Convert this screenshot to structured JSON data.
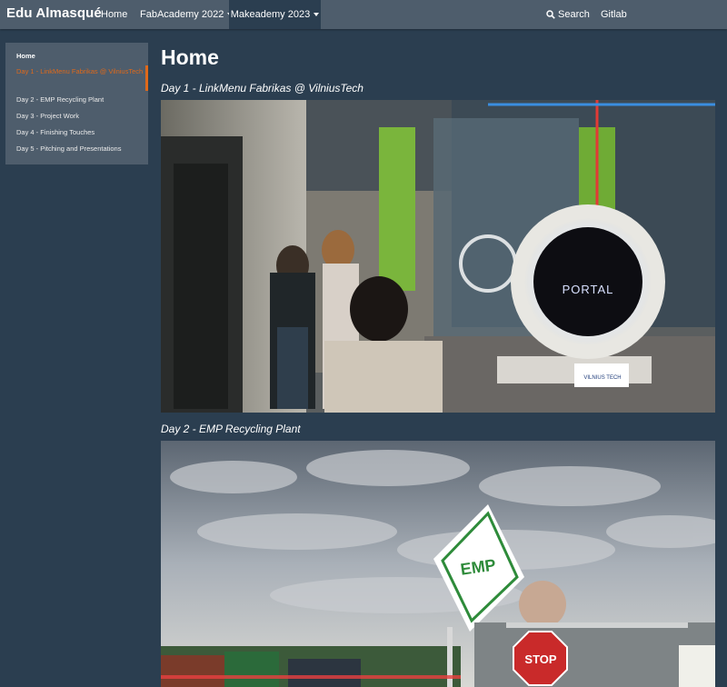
{
  "navbar": {
    "brand": "Edu Almasqué",
    "items": [
      {
        "label": "Home"
      },
      {
        "label": "FabAcademy 2022"
      },
      {
        "label": "Makeademy 2023"
      }
    ],
    "search_label": "Search",
    "gitlab_label": "Gitlab"
  },
  "sidebar": {
    "items": [
      {
        "label": "Home"
      },
      {
        "label": "Day 1 - LinkMenu Fabrikas @ VilniusTech"
      },
      {
        "label": "Day 2 - EMP Recycling Plant"
      },
      {
        "label": "Day 3 - Project Work"
      },
      {
        "label": "Day 4 - Finishing Touches"
      },
      {
        "label": "Day 5 - Pitching and Presentations"
      }
    ]
  },
  "main": {
    "title": "Home",
    "sections": [
      {
        "heading": "Day 1 - LinkMenu Fabrikas @ VilniusTech",
        "banner_text": "PORTAL",
        "badge_text": "VILNIUS TECH"
      },
      {
        "heading": "Day 2 - EMP Recycling Plant",
        "sign_text": "EMP",
        "stop_text": "STOP"
      }
    ]
  },
  "colors": {
    "navbar": "#4e5d6c",
    "background": "#2b3e50",
    "accent": "#df691a"
  },
  "icons": {
    "search": "search-icon"
  }
}
